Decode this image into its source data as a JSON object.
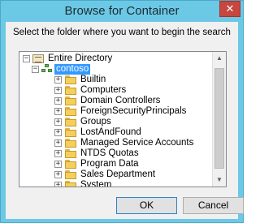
{
  "window": {
    "title": "Browse for Container",
    "close_glyph": "✕"
  },
  "instruction": "Select the folder where you want to begin the search",
  "tree": {
    "root": {
      "label": "Entire Directory",
      "expander": "−"
    },
    "domain": {
      "label": "contoso",
      "expander": "−"
    },
    "items": [
      {
        "label": "Builtin",
        "expander": "+"
      },
      {
        "label": "Computers",
        "expander": "+"
      },
      {
        "label": "Domain Controllers",
        "expander": "+"
      },
      {
        "label": "ForeignSecurityPrincipals",
        "expander": "+"
      },
      {
        "label": "Groups",
        "expander": "+"
      },
      {
        "label": "LostAndFound",
        "expander": "+"
      },
      {
        "label": "Managed Service Accounts",
        "expander": "+"
      },
      {
        "label": "NTDS Quotas",
        "expander": "+"
      },
      {
        "label": "Program Data",
        "expander": "+"
      },
      {
        "label": "Sales Department",
        "expander": "+"
      },
      {
        "label": "System",
        "expander": "+"
      }
    ]
  },
  "scrollbar": {
    "up_glyph": "▲",
    "down_glyph": "▼"
  },
  "buttons": {
    "ok": "OK",
    "cancel": "Cancel"
  }
}
